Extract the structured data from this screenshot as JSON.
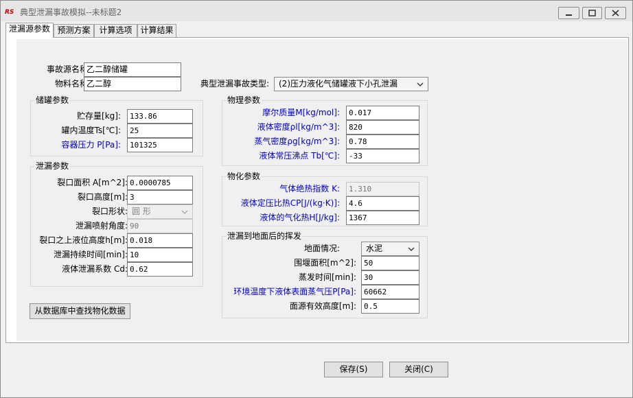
{
  "window": {
    "title": "典型泄漏事故模拟--未标题2"
  },
  "tabs": [
    "泄漏源参数",
    "预测方案",
    "计算选项",
    "计算结果"
  ],
  "top": {
    "accident_name_label": "事故源名称:",
    "accident_name_value": "乙二醇储罐",
    "material_label": "物料名称:",
    "material_value": "乙二醇",
    "accident_type_label": "典型泄漏事故类型:",
    "accident_type_value": "(2)压力液化气储罐液下小孔泄漏"
  },
  "storage": {
    "title": "储罐参数",
    "rows": [
      {
        "label": "贮存量[kg]:",
        "value": "133.86"
      },
      {
        "label": "罐内温度Ts[℃]:",
        "value": "25"
      },
      {
        "label": "容器压力 P[Pa]:",
        "value": "101325"
      }
    ]
  },
  "leak": {
    "title": "泄漏参数",
    "area_label": "裂口面积 A[m^2]:",
    "area_value": "0.0000785",
    "height_label": "裂口高度[m]:",
    "height_value": "3",
    "shape_label": "裂口形状:",
    "shape_value": "圆  形",
    "angle_label": "泄漏喷射角度:",
    "angle_value": "90",
    "level_label": "裂口之上液位高度h[m]:",
    "level_value": "0.018",
    "duration_label": "泄漏持续时间[min]:",
    "duration_value": "10",
    "coef_label": "液体泄漏系数  Cd:",
    "coef_value": "0.62"
  },
  "physical": {
    "title": "物理参数",
    "rows": [
      {
        "label": "摩尔质量M[kg/mol]:",
        "value": "0.017"
      },
      {
        "label": "液体密度ρl[kg/m^3]:",
        "value": "820"
      },
      {
        "label": "蒸气密度ρg[kg/m^3]:",
        "value": "0.78"
      },
      {
        "label": "液体常压沸点 Tb[℃]:",
        "value": "-33"
      }
    ]
  },
  "chemical": {
    "title": "物化参数",
    "rows": [
      {
        "label": "气体绝热指数 K:",
        "value": "1.310"
      },
      {
        "label": "液体定压比热CP[J/(kg·K)]:",
        "value": "4.6"
      },
      {
        "label": "液体的气化热H[J/kg]:",
        "value": "1367"
      }
    ]
  },
  "evap": {
    "title": "泄漏到地面后的挥发",
    "ground_label": "地面情况:",
    "ground_value": "水泥",
    "rows": [
      {
        "label": "围堰面积[m^2]:",
        "value": "50"
      },
      {
        "label": "蒸发时间[min]:",
        "value": "30"
      },
      {
        "label": "环境温度下液体表面蒸气压P[Pa]:",
        "value": "60662"
      },
      {
        "label": "面源有效高度[m]:",
        "value": "0.5"
      }
    ]
  },
  "buttons": {
    "lookup": "从数据库中查找物化数据",
    "save": "保存(S)",
    "close": "关闭(C)"
  }
}
